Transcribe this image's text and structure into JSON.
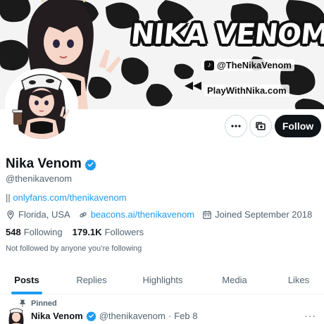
{
  "banner": {
    "title": "NIKA VENOM",
    "tiktok": "@TheNikaVenom",
    "website": "PlayWithNika.com"
  },
  "actions": {
    "more_icon": "more-horizontal-icon",
    "subscribe_icon": "notification-subscribe-icon",
    "follow_label": "Follow"
  },
  "profile": {
    "display_name": "Nika Venom",
    "verified_icon": "verified-badge-icon",
    "handle": "@thenikavenom",
    "bio_prefix": "||",
    "bio_link": "onlyfans.com/thenikavenom",
    "location": "Florida, USA",
    "website": "beacons.ai/thenikavenom",
    "joined": "Joined September 2018",
    "following_count": "548",
    "following_label": "Following",
    "followers_count": "179.1K",
    "followers_label": "Followers",
    "followed_by": "Not followed by anyone you’re following"
  },
  "tabs": [
    {
      "label": "Posts",
      "active": true
    },
    {
      "label": "Replies",
      "active": false
    },
    {
      "label": "Highlights",
      "active": false
    },
    {
      "label": "Media",
      "active": false
    },
    {
      "label": "Likes",
      "active": false
    }
  ],
  "pinned_tweet": {
    "pinned_label": "Pinned",
    "name": "Nika Venom",
    "handle": "@thenikavenom",
    "separator": "·",
    "date": "Feb 8"
  },
  "colors": {
    "accent": "#1d9bf0",
    "text_primary": "#0f1419",
    "text_secondary": "#536471",
    "follow_button": "#0f1419"
  }
}
